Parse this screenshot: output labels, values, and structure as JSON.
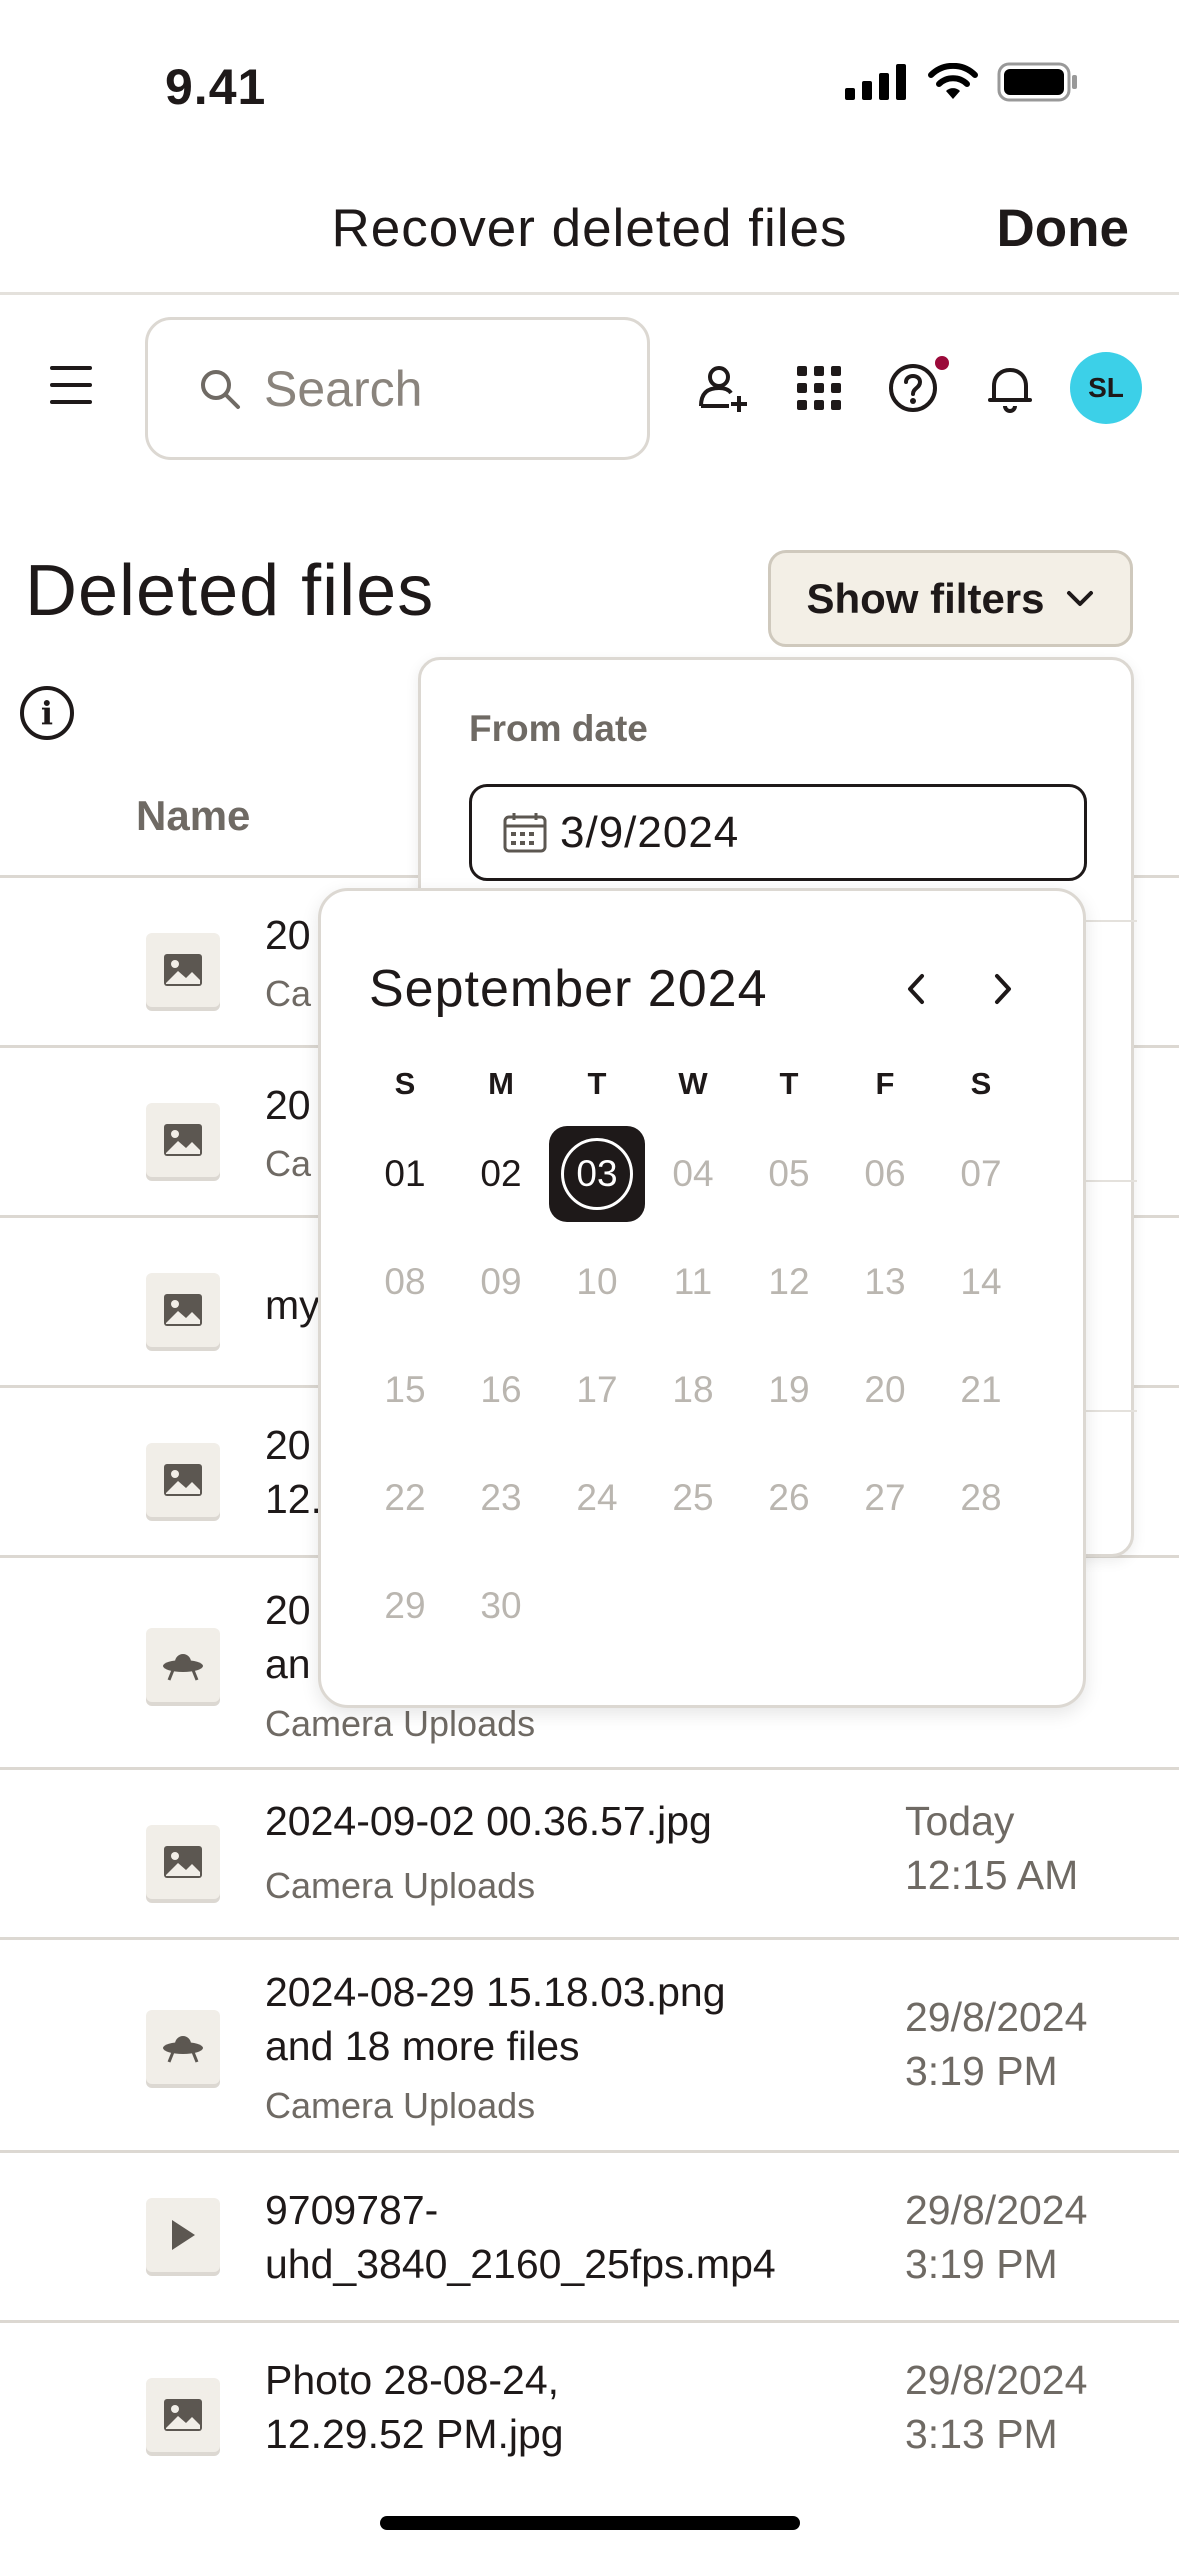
{
  "status_bar": {
    "time": "9.41"
  },
  "modal": {
    "title": "Recover deleted files",
    "done_label": "Done"
  },
  "nav": {
    "search_placeholder": "Search",
    "avatar_initials": "SL",
    "avatar_color": "#3cd0e8",
    "help_badge_color": "#9b0a3a"
  },
  "page": {
    "title": "Deleted files",
    "filters_label": "Show filters",
    "column_name": "Name"
  },
  "files": [
    {
      "name": "20",
      "folder": "Ca",
      "icon": "image-icon"
    },
    {
      "name": "20",
      "folder": "Ca",
      "icon": "image-icon"
    },
    {
      "name": "my",
      "icon": "image-icon"
    },
    {
      "name": "20",
      "name2": "12.",
      "icon": "image-icon"
    },
    {
      "name": "20",
      "name2": "an",
      "folder": "Camera Uploads",
      "icon": "ufo-icon"
    },
    {
      "name": "2024-09-02 00.36.57.jpg",
      "folder": "Camera Uploads",
      "date": "Today",
      "time": "12:15 AM",
      "icon": "image-icon"
    },
    {
      "name": "2024-08-29 15.18.03.png",
      "name2": "and 18 more files",
      "folder": "Camera Uploads",
      "date": "29/8/2024",
      "time": "3:19 PM",
      "icon": "ufo-icon"
    },
    {
      "name": "9709787-",
      "name2": "uhd_3840_2160_25fps.mp4",
      "date": "29/8/2024",
      "time": "3:19 PM",
      "icon": "play-icon"
    },
    {
      "name": "Photo 28-08-24,",
      "name2": "12.29.52 PM.jpg",
      "date": "29/8/2024",
      "time": "3:13 PM",
      "icon": "image-icon"
    }
  ],
  "filter": {
    "from_label": "From date",
    "from_value": "3/9/2024"
  },
  "calendar": {
    "month_label": "September 2024",
    "weekdays": [
      "S",
      "M",
      "T",
      "W",
      "T",
      "F",
      "S"
    ],
    "weeks": [
      [
        "01",
        "02",
        "03",
        "04",
        "05",
        "06",
        "07"
      ],
      [
        "08",
        "09",
        "10",
        "11",
        "12",
        "13",
        "14"
      ],
      [
        "15",
        "16",
        "17",
        "18",
        "19",
        "20",
        "21"
      ],
      [
        "22",
        "23",
        "24",
        "25",
        "26",
        "27",
        "28"
      ],
      [
        "29",
        "30"
      ]
    ],
    "selected": "03"
  }
}
